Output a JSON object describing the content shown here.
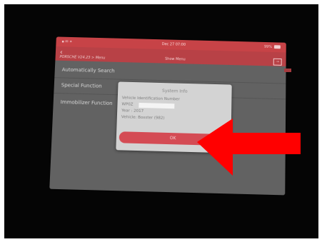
{
  "status_bar": {
    "date_time": "Dec 27  07:00",
    "battery_pct": "99%"
  },
  "header": {
    "breadcrumb": "PORSCHE V24.23 > Menu",
    "title": "Show Menu"
  },
  "menu_items": [
    {
      "label": "Automatically Search"
    },
    {
      "label": "Special Function"
    },
    {
      "label": "Immobilizer Function"
    }
  ],
  "dialog": {
    "title": "System Info",
    "lines": [
      "Vehicle Identification Number",
      "WP0Z",
      "Year : 2017",
      "Vehicle: Boxster (982)"
    ],
    "ok_label": "OK"
  },
  "colors": {
    "accent": "#c74347",
    "button": "#d44b54",
    "overlay_arrow": "#ff0000"
  },
  "icons": {
    "back": "chevron-left-icon",
    "exit": "exit-icon"
  }
}
